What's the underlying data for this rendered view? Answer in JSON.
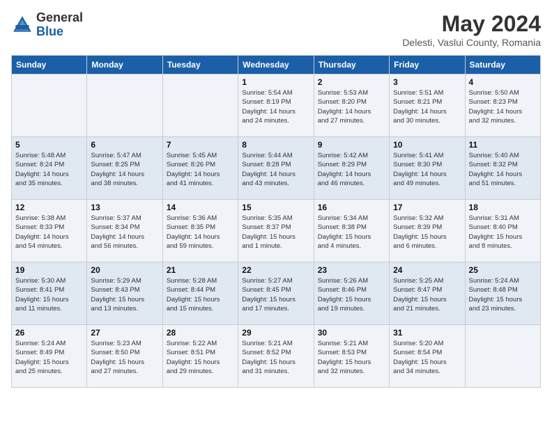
{
  "header": {
    "logo_general": "General",
    "logo_blue": "Blue",
    "month": "May 2024",
    "location": "Delesti, Vaslui County, Romania"
  },
  "weekdays": [
    "Sunday",
    "Monday",
    "Tuesday",
    "Wednesday",
    "Thursday",
    "Friday",
    "Saturday"
  ],
  "weeks": [
    [
      {
        "day": "",
        "info": ""
      },
      {
        "day": "",
        "info": ""
      },
      {
        "day": "",
        "info": ""
      },
      {
        "day": "1",
        "info": "Sunrise: 5:54 AM\nSunset: 8:19 PM\nDaylight: 14 hours\nand 24 minutes."
      },
      {
        "day": "2",
        "info": "Sunrise: 5:53 AM\nSunset: 8:20 PM\nDaylight: 14 hours\nand 27 minutes."
      },
      {
        "day": "3",
        "info": "Sunrise: 5:51 AM\nSunset: 8:21 PM\nDaylight: 14 hours\nand 30 minutes."
      },
      {
        "day": "4",
        "info": "Sunrise: 5:50 AM\nSunset: 8:23 PM\nDaylight: 14 hours\nand 32 minutes."
      }
    ],
    [
      {
        "day": "5",
        "info": "Sunrise: 5:48 AM\nSunset: 8:24 PM\nDaylight: 14 hours\nand 35 minutes."
      },
      {
        "day": "6",
        "info": "Sunrise: 5:47 AM\nSunset: 8:25 PM\nDaylight: 14 hours\nand 38 minutes."
      },
      {
        "day": "7",
        "info": "Sunrise: 5:45 AM\nSunset: 8:26 PM\nDaylight: 14 hours\nand 41 minutes."
      },
      {
        "day": "8",
        "info": "Sunrise: 5:44 AM\nSunset: 8:28 PM\nDaylight: 14 hours\nand 43 minutes."
      },
      {
        "day": "9",
        "info": "Sunrise: 5:42 AM\nSunset: 8:29 PM\nDaylight: 14 hours\nand 46 minutes."
      },
      {
        "day": "10",
        "info": "Sunrise: 5:41 AM\nSunset: 8:30 PM\nDaylight: 14 hours\nand 49 minutes."
      },
      {
        "day": "11",
        "info": "Sunrise: 5:40 AM\nSunset: 8:32 PM\nDaylight: 14 hours\nand 51 minutes."
      }
    ],
    [
      {
        "day": "12",
        "info": "Sunrise: 5:38 AM\nSunset: 8:33 PM\nDaylight: 14 hours\nand 54 minutes."
      },
      {
        "day": "13",
        "info": "Sunrise: 5:37 AM\nSunset: 8:34 PM\nDaylight: 14 hours\nand 56 minutes."
      },
      {
        "day": "14",
        "info": "Sunrise: 5:36 AM\nSunset: 8:35 PM\nDaylight: 14 hours\nand 59 minutes."
      },
      {
        "day": "15",
        "info": "Sunrise: 5:35 AM\nSunset: 8:37 PM\nDaylight: 15 hours\nand 1 minute."
      },
      {
        "day": "16",
        "info": "Sunrise: 5:34 AM\nSunset: 8:38 PM\nDaylight: 15 hours\nand 4 minutes."
      },
      {
        "day": "17",
        "info": "Sunrise: 5:32 AM\nSunset: 8:39 PM\nDaylight: 15 hours\nand 6 minutes."
      },
      {
        "day": "18",
        "info": "Sunrise: 5:31 AM\nSunset: 8:40 PM\nDaylight: 15 hours\nand 8 minutes."
      }
    ],
    [
      {
        "day": "19",
        "info": "Sunrise: 5:30 AM\nSunset: 8:41 PM\nDaylight: 15 hours\nand 11 minutes."
      },
      {
        "day": "20",
        "info": "Sunrise: 5:29 AM\nSunset: 8:43 PM\nDaylight: 15 hours\nand 13 minutes."
      },
      {
        "day": "21",
        "info": "Sunrise: 5:28 AM\nSunset: 8:44 PM\nDaylight: 15 hours\nand 15 minutes."
      },
      {
        "day": "22",
        "info": "Sunrise: 5:27 AM\nSunset: 8:45 PM\nDaylight: 15 hours\nand 17 minutes."
      },
      {
        "day": "23",
        "info": "Sunrise: 5:26 AM\nSunset: 8:46 PM\nDaylight: 15 hours\nand 19 minutes."
      },
      {
        "day": "24",
        "info": "Sunrise: 5:25 AM\nSunset: 8:47 PM\nDaylight: 15 hours\nand 21 minutes."
      },
      {
        "day": "25",
        "info": "Sunrise: 5:24 AM\nSunset: 8:48 PM\nDaylight: 15 hours\nand 23 minutes."
      }
    ],
    [
      {
        "day": "26",
        "info": "Sunrise: 5:24 AM\nSunset: 8:49 PM\nDaylight: 15 hours\nand 25 minutes."
      },
      {
        "day": "27",
        "info": "Sunrise: 5:23 AM\nSunset: 8:50 PM\nDaylight: 15 hours\nand 27 minutes."
      },
      {
        "day": "28",
        "info": "Sunrise: 5:22 AM\nSunset: 8:51 PM\nDaylight: 15 hours\nand 29 minutes."
      },
      {
        "day": "29",
        "info": "Sunrise: 5:21 AM\nSunset: 8:52 PM\nDaylight: 15 hours\nand 31 minutes."
      },
      {
        "day": "30",
        "info": "Sunrise: 5:21 AM\nSunset: 8:53 PM\nDaylight: 15 hours\nand 32 minutes."
      },
      {
        "day": "31",
        "info": "Sunrise: 5:20 AM\nSunset: 8:54 PM\nDaylight: 15 hours\nand 34 minutes."
      },
      {
        "day": "",
        "info": ""
      }
    ]
  ]
}
